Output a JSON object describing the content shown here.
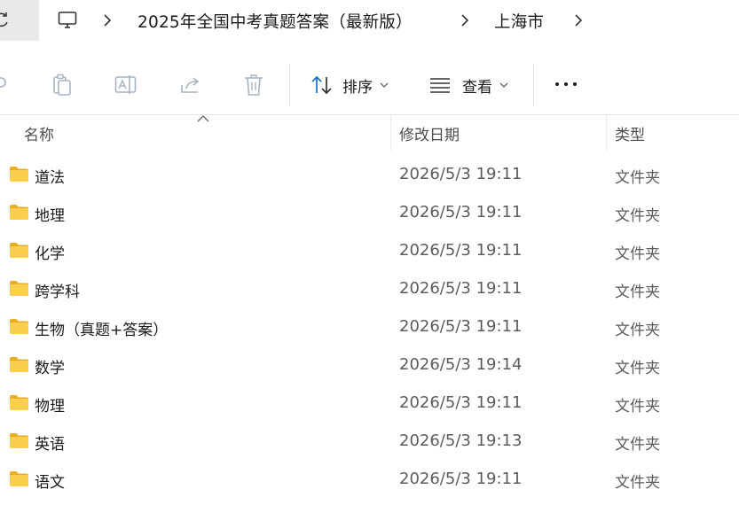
{
  "breadcrumb": {
    "items": [
      "2025年全国中考真题答案（最新版）",
      "上海市"
    ]
  },
  "toolbar": {
    "sort_label": "排序",
    "view_label": "查看"
  },
  "columns": {
    "name": "名称",
    "date": "修改日期",
    "type": "类型"
  },
  "files": [
    {
      "name": "道法",
      "date": "2026/5/3 19:11",
      "type": "文件夹"
    },
    {
      "name": "地理",
      "date": "2026/5/3 19:11",
      "type": "文件夹"
    },
    {
      "name": "化学",
      "date": "2026/5/3 19:11",
      "type": "文件夹"
    },
    {
      "name": "跨学科",
      "date": "2026/5/3 19:11",
      "type": "文件夹"
    },
    {
      "name": "生物（真题+答案）",
      "date": "2026/5/3 19:11",
      "type": "文件夹"
    },
    {
      "name": "数学",
      "date": "2026/5/3 19:14",
      "type": "文件夹"
    },
    {
      "name": "物理",
      "date": "2026/5/3 19:11",
      "type": "文件夹"
    },
    {
      "name": "英语",
      "date": "2026/5/3 19:13",
      "type": "文件夹"
    },
    {
      "name": "语文",
      "date": "2026/5/3 19:11",
      "type": "文件夹"
    }
  ],
  "icons": {
    "refresh": "refresh-icon",
    "computer": "this-pc-icon",
    "cut": "cut-icon",
    "copy": "copy-icon",
    "rename": "rename-icon",
    "share": "share-icon",
    "delete": "delete-icon",
    "sort": "sort-icon",
    "view": "view-icon",
    "more": "more-icon",
    "folder": "folder-icon"
  },
  "colors": {
    "folder": "#f7c948",
    "sort_accent": "#1a6fc2",
    "disabled_icon": "#a8b4c0"
  }
}
